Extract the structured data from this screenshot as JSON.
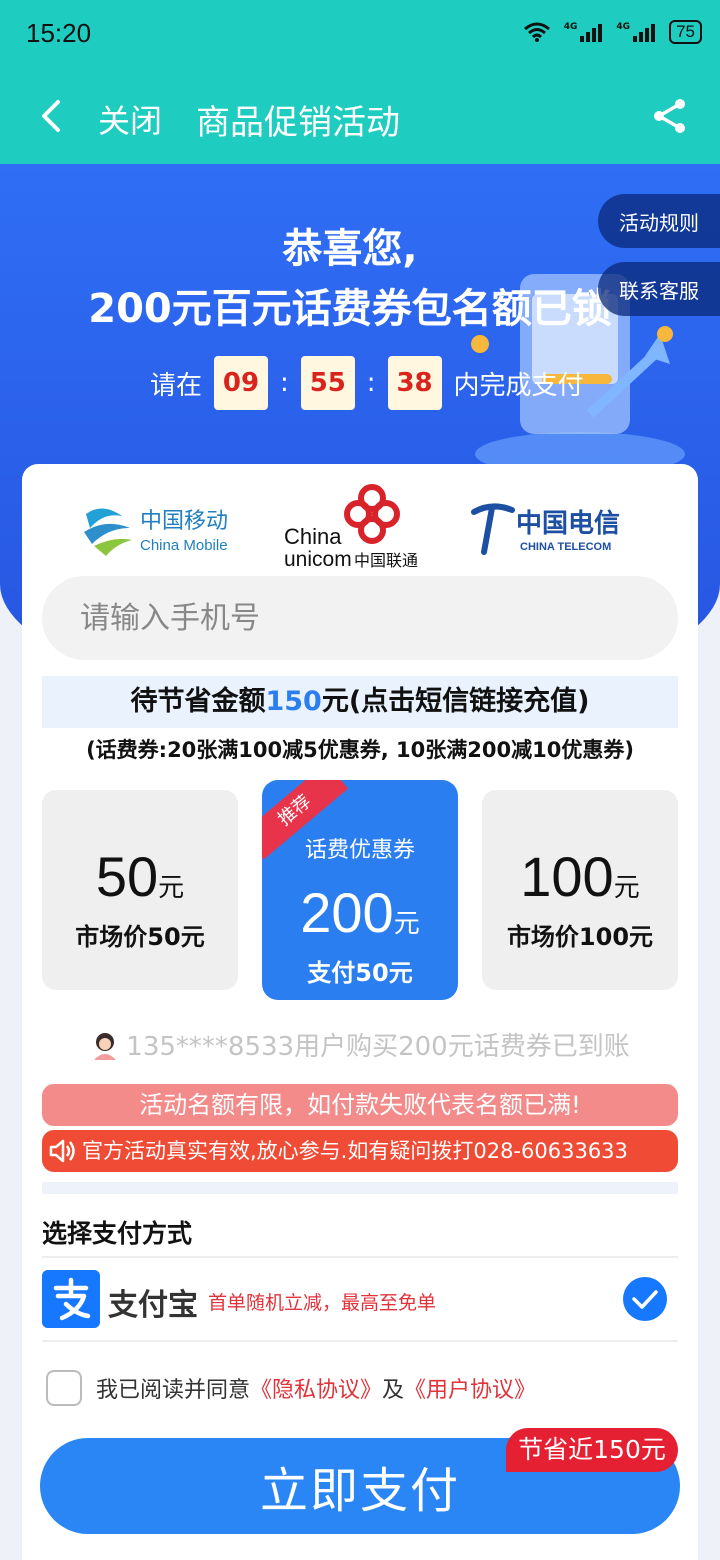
{
  "status": {
    "time": "15:20",
    "battery": "75",
    "net1": "4G",
    "net2": "4G"
  },
  "header": {
    "close_label": "关闭",
    "title": "商品促销活动"
  },
  "hero": {
    "line1": "恭喜您,",
    "line2": "200元百元话费券包名额已锁",
    "timer_prefix": "请在",
    "timer": {
      "h": "09",
      "m": "55",
      "s": "38",
      "sep": ":"
    },
    "timer_suffix": "内完成支付",
    "rules_label": "活动规则",
    "support_label": "联系客服"
  },
  "carriers": {
    "mobile_cn": "中国移动",
    "mobile_en": "China Mobile",
    "unicom_en1": "China",
    "unicom_en2": "unicom",
    "unicom_cn": "中国联通",
    "telecom_cn": "中国电信",
    "telecom_en": "CHINA TELECOM"
  },
  "phone": {
    "placeholder": "请输入手机号"
  },
  "save_banner": {
    "pre": "待节省金额",
    "amount": "150",
    "post": "元(点击短信链接充值)"
  },
  "coupon_desc": "(话费券:20张满100减5优惠券, 10张满200减10优惠券)",
  "options": [
    {
      "amount": "50",
      "unit": "元",
      "price": "市场价50元"
    },
    {
      "badge": "推荐",
      "subtitle": "话费优惠券",
      "amount": "200",
      "unit": "元",
      "price": "支付50元"
    },
    {
      "amount": "100",
      "unit": "元",
      "price": "市场价100元"
    }
  ],
  "notify_text": "135****8533用户购买200元话费券已到账",
  "warn_text": "活动名额有限，如付款失败代表名额已满!",
  "info_text": "官方活动真实有效,放心参与.如有疑问拨打028-60633633",
  "payment": {
    "section_label": "选择支付方式",
    "method_name": "支付宝",
    "method_promo": "首单随机立减，最高至免单"
  },
  "agreement": {
    "pre": "我已阅读并同意",
    "privacy": "《隐私协议》",
    "and": "及",
    "user": "《用户协议》"
  },
  "pay_button": "立即支付",
  "save_badge": "节省近150元",
  "colors": {
    "header": "#1ecdbf",
    "hero": "#2f6ef5",
    "primary": "#2a86f5",
    "warn": "#ef4b35"
  }
}
